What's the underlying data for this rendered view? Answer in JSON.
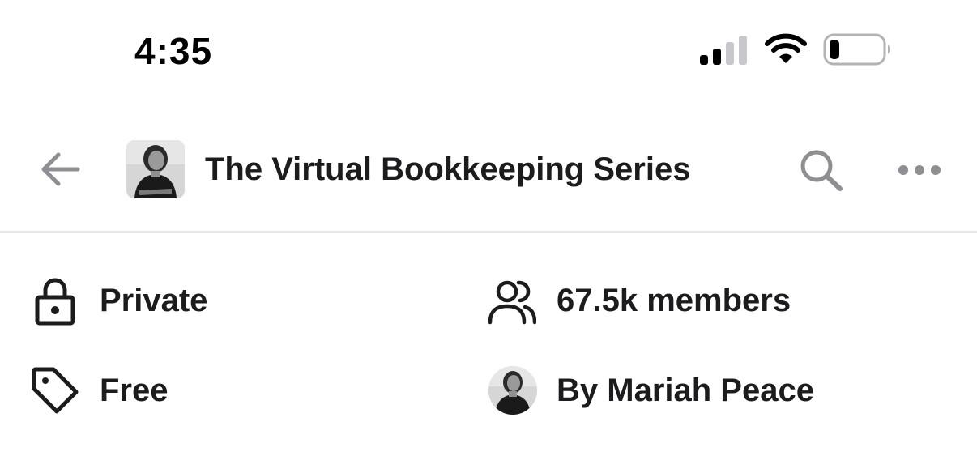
{
  "status_bar": {
    "time": "4:35",
    "signal_icon": "cellular-signal-icon",
    "wifi_icon": "wifi-icon",
    "battery_icon": "battery-low-icon",
    "battery_level": 0.12
  },
  "header": {
    "back_icon": "arrow-left-icon",
    "group_title": "The Virtual Bookkeeping Series",
    "search_icon": "search-icon",
    "more_icon": "more-horizontal-icon"
  },
  "info": {
    "privacy": {
      "icon": "lock-icon",
      "label": "Private"
    },
    "members": {
      "icon": "users-icon",
      "label": "67.5k members"
    },
    "price": {
      "icon": "tag-icon",
      "label": "Free"
    },
    "owner": {
      "icon": "owner-avatar",
      "label": "By Mariah Peace"
    }
  },
  "colors": {
    "text": "#1c1c1e",
    "icon_gray": "#8e8e93",
    "divider": "#e4e4e6",
    "background": "#ffffff"
  }
}
